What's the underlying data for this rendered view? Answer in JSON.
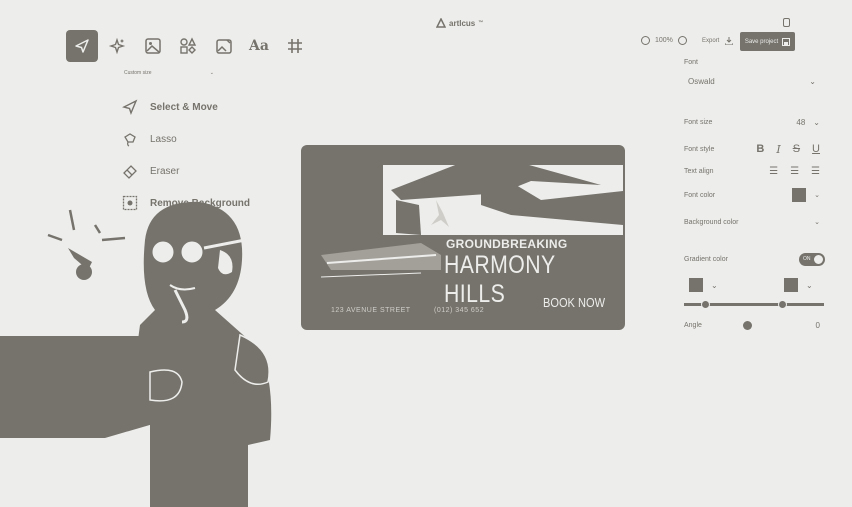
{
  "brand": {
    "name": "artlcus",
    "suffix": "™"
  },
  "toolbar": {
    "tools": [
      {
        "name": "select-move",
        "icon": "cursor-icon"
      },
      {
        "name": "ai-magic",
        "icon": "sparkles-icon"
      },
      {
        "name": "image",
        "icon": "image-icon"
      },
      {
        "name": "shapes",
        "icon": "shapes-icon"
      },
      {
        "name": "gallery",
        "icon": "image-edit-icon"
      },
      {
        "name": "text",
        "icon": "text-icon",
        "label": "Aa"
      },
      {
        "name": "grid",
        "icon": "hash-icon"
      }
    ]
  },
  "zoom": {
    "value": "100%"
  },
  "export_label": "Export",
  "save_label": "Save project",
  "size_select": {
    "value": "Custom size"
  },
  "tool_menu": {
    "items": [
      {
        "label": "Select & Move",
        "icon": "cursor-icon"
      },
      {
        "label": "Lasso",
        "icon": "lasso-icon"
      },
      {
        "label": "Eraser",
        "icon": "eraser-icon"
      },
      {
        "label": "Remove Background",
        "icon": "remove-bg-icon"
      }
    ]
  },
  "card": {
    "headline": "GROUNDBREAKING",
    "title": "HARMONY HILLS",
    "address": "123 AVENUE STREET",
    "phone": "(012) 345 652",
    "cta": "BOOK NOW"
  },
  "panel": {
    "font_label": "Font",
    "font_value": "Oswald",
    "font_size_label": "Font size",
    "font_size_value": "48",
    "font_style_label": "Font style",
    "text_align_label": "Text align",
    "font_color_label": "Font color",
    "bg_color_label": "Background color",
    "gradient_label": "Gradient color",
    "gradient_toggle": "ON",
    "angle_label": "Angle",
    "angle_value": "0"
  },
  "colors": {
    "ink": "#76736c",
    "bg": "#ededeb"
  }
}
